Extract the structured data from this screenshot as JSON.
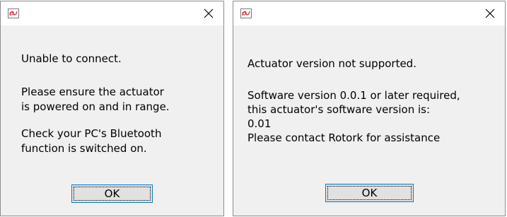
{
  "dialog1": {
    "icon": "rotork-app-icon",
    "close_icon": "close-icon",
    "line1": "Unable to connect.",
    "line2": "Please ensure the actuator",
    "line3": "is powered on and in range.",
    "line4": "Check your PC's Bluetooth",
    "line5": "function is switched on.",
    "ok_label": "OK"
  },
  "dialog2": {
    "icon": "rotork-app-icon",
    "close_icon": "close-icon",
    "line1": "Actuator version not supported.",
    "line2": "Software version 0.0.1 or later required,",
    "line3": "this actuator's software version is:",
    "line4": "0.01",
    "line5": "Please contact Rotork for assistance",
    "ok_label": "OK"
  },
  "colors": {
    "dialog_background": "#f0f0f0",
    "titlebar_background": "#ffffff",
    "button_focus_border": "#0078d7",
    "icon_accent": "#d9363e"
  }
}
